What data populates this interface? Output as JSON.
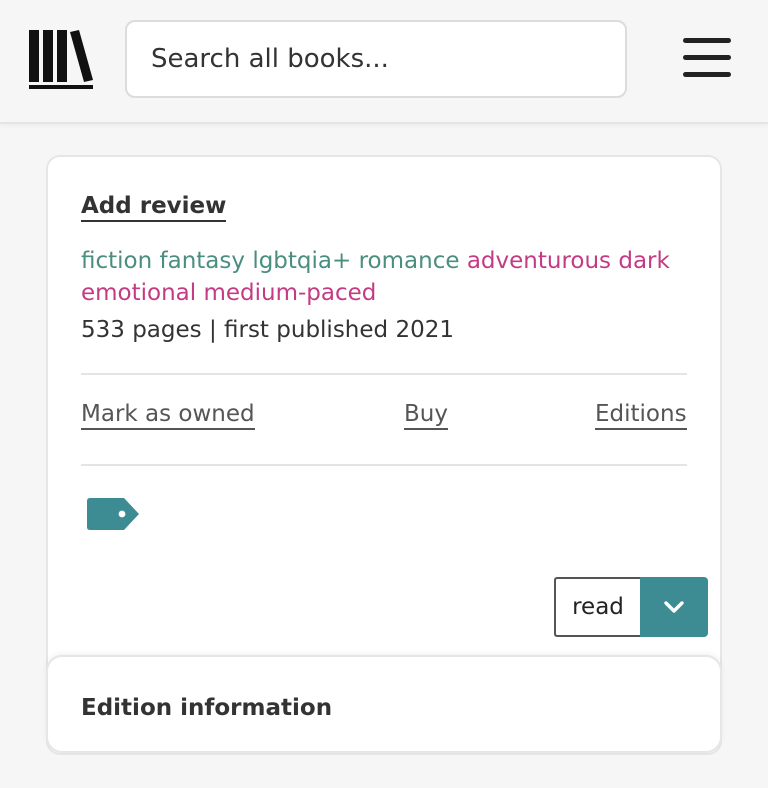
{
  "header": {
    "logo_icon": "library-books-icon",
    "search": {
      "placeholder": "Search all books..."
    },
    "menu_icon": "hamburger-menu-icon"
  },
  "book_card": {
    "add_review_label": "Add review",
    "genres": [
      "fiction",
      "fantasy",
      "lgbtqia+",
      "romance"
    ],
    "moods": [
      "adventurous",
      "dark",
      "emotional",
      "medium-paced"
    ],
    "genre_color": "#4a8e7f",
    "mood_color": "#c43b84",
    "meta": "533 pages | first published 2021",
    "actions": {
      "mark_owned": "Mark as owned",
      "buy": "Buy",
      "editions": "Editions"
    },
    "tag_icon": "tag-icon",
    "status": {
      "value": "read",
      "dropdown_icon": "chevron-down-icon",
      "accent": "#3e8c93"
    }
  },
  "edition_panel": {
    "title": "Edition information"
  }
}
